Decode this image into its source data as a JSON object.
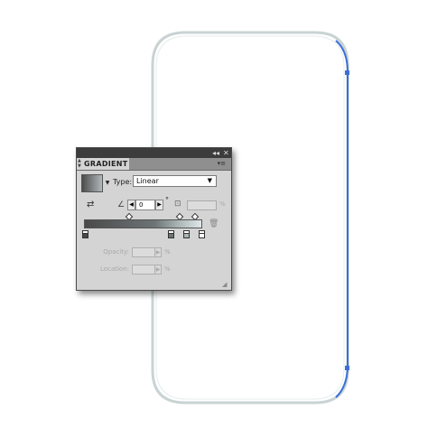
{
  "panel": {
    "tab_label": "GRADIENT",
    "collapse_icon": "double-chevron-icon",
    "close_icon": "close-icon",
    "menu_icon": "panel-menu-icon"
  },
  "type": {
    "label": "Type:",
    "value": "Linear"
  },
  "angle": {
    "value": "0",
    "unit": "°"
  },
  "aspect": {
    "unit": "%"
  },
  "opacity": {
    "label": "Opacity:",
    "unit": "%"
  },
  "location": {
    "label": "Location:",
    "unit": "%"
  },
  "colors": {
    "selection_blue": "#3a6fd8",
    "shape_stroke": "#c9d3d3",
    "panel_bg": "#d4d4d4"
  }
}
